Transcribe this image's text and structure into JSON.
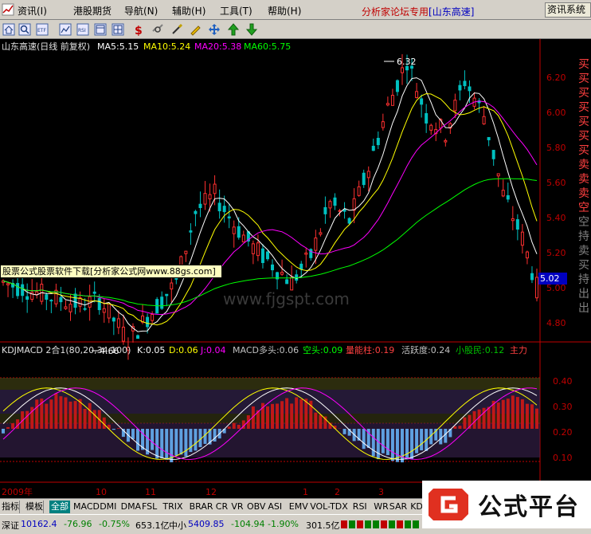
{
  "menu": {
    "items": [
      "资讯(I)",
      "港股期货",
      "导航(N)",
      "辅助(H)",
      "工具(T)",
      "帮助(H)"
    ],
    "brand_prefix": "分析家论坛专用",
    "brand_region": "[山东高速]",
    "system_button": "资讯系统"
  },
  "toolbar": {
    "icons": [
      "home-icon",
      "search-icon",
      "etf-icon",
      "chart-icon",
      "rsi-icon",
      "window-icon",
      "dollar-icon",
      "link-icon",
      "pencil-icon",
      "move-icon",
      "up-arrow-icon",
      "down-arrow-icon"
    ]
  },
  "main_chart": {
    "title": "山东高速(日线 前复权)",
    "ma5": "MA5:5.15",
    "ma10": "MA10:5.24",
    "ma20": "MA20:5.38",
    "ma60": "MA60:5.75",
    "y_ticks": [
      "6.20",
      "6.00",
      "5.80",
      "5.60",
      "5.40",
      "5.20",
      "5.00",
      "4.80"
    ],
    "high_label": "6.32",
    "low_label": "4.66",
    "last_price": "5.02",
    "right_strip_text": "买买买买买买买卖卖卖空空持卖买持出出"
  },
  "watermark": "www.fjgspt.com",
  "ad_banner": "股票公式股票软件下载[分析家公式网www.88gs.com]",
  "indicator": {
    "title": "KDJMACD 2合1(80,20,34,100)",
    "k": "K:0.05",
    "d": "D:0.06",
    "j": "J:0.04",
    "macd_long": "MACD多头:0.06",
    "kong": "空头:0.09",
    "liang": "量能柱:0.19",
    "active": "活跃度:0.24",
    "retail": "小股民:0.12",
    "extra": "主力",
    "y_ticks": [
      "0.40",
      "0.30",
      "0.20",
      "0.10"
    ]
  },
  "x_axis": {
    "year_label": "2009年",
    "months": [
      "10",
      "11",
      "12",
      "1",
      "2",
      "3"
    ]
  },
  "tabs": [
    "指标",
    "模板",
    "全部",
    "MACD",
    "DMI",
    "DMA",
    "FSL",
    "TRIX",
    "BRAR",
    "CR",
    "VR",
    "OBV",
    "ASI",
    "EMV",
    "VOL-TDX",
    "RSI",
    "WR",
    "SAR",
    "KDJ"
  ],
  "status": {
    "sz_label": "深证",
    "sz_value": "10162.4",
    "sz_change": "-76.96",
    "sz_pct": "-0.75%",
    "sz_amount": "653.1亿",
    "zx_label": "中小",
    "zx_value": "5409.85",
    "zx_change": "-104.94",
    "zx_pct": "-1.90%",
    "zx_amount": "301.5亿"
  },
  "badge": {
    "text": "公式平台"
  },
  "colors": {
    "up": "#ff3030",
    "down": "#00c0c0",
    "ma5": "#ffffff",
    "ma10": "#ffff00",
    "ma20": "#ff00ff",
    "ma60": "#00ff00",
    "axis": "#c00000"
  }
}
